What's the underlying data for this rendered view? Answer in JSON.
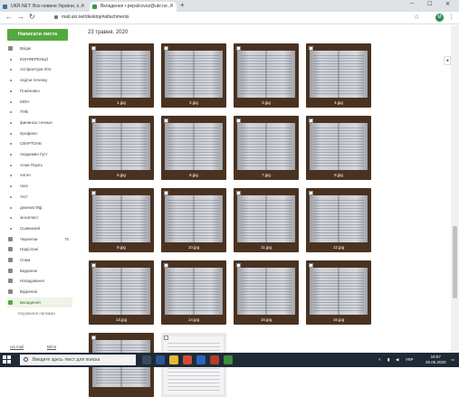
{
  "browser": {
    "tabs": [
      {
        "title": "UKR.NET: Все новини України, о..."
      },
      {
        "title": "Вкладення • pepalcovoz@ukr.ne..."
      }
    ],
    "url": "mail.ukr.net/desktop#attachments",
    "avatar_letter": "M"
  },
  "sidebar": {
    "compose_label": "Написати листа",
    "folders": [
      {
        "label": "Вхідні",
        "icon": "inbox-icon"
      },
      {
        "label": "КОНФЕРЕНЦІЇ",
        "icon": "folder-dot"
      },
      {
        "label": "Аспірантура 204",
        "icon": "folder-dot"
      },
      {
        "label": "свідчи теченку",
        "icon": "folder-dot"
      },
      {
        "label": "Помічнико",
        "icon": "folder-dot"
      },
      {
        "label": "МОН",
        "icon": "folder-dot"
      },
      {
        "label": "ТНВ",
        "icon": "folder-dot"
      },
      {
        "label": "финансы сочные",
        "icon": "folder-dot"
      },
      {
        "label": "профили",
        "icon": "folder-dot"
      },
      {
        "label": "СВАРТОАБ",
        "icon": "folder-dot"
      },
      {
        "label": "Академия Густ",
        "icon": "folder-dot"
      },
      {
        "label": "Алиа Паупъ",
        "icon": "folder-dot"
      },
      {
        "label": "чатон",
        "icon": "folder-dot"
      },
      {
        "label": "гаха",
        "icon": "folder-dot"
      },
      {
        "label": "тест",
        "icon": "folder-dot"
      },
      {
        "label": "декенат.Фф",
        "icon": "folder-dot"
      },
      {
        "label": "экзопласт",
        "icon": "folder-dot"
      },
      {
        "label": "Сшмнизей",
        "icon": "folder-dot"
      },
      {
        "label": "Чернетки",
        "icon": "drafts-icon",
        "count": "76"
      },
      {
        "label": "Надіслані",
        "icon": "sent-icon"
      },
      {
        "label": "Спам",
        "icon": "spam-icon"
      },
      {
        "label": "Видалені",
        "icon": "trash-icon"
      },
      {
        "label": "Нагадування",
        "icon": "reminder-icon"
      },
      {
        "label": "Відмічені",
        "icon": "star-icon"
      },
      {
        "label": "Вкладення",
        "icon": "attachment-icon",
        "active": true
      }
    ],
    "manage_label": "Керування папками",
    "footer": [
      "Ua mail",
      "Вйти"
    ]
  },
  "main": {
    "date_heading": "23 травня, 2020",
    "attachments": [
      "1.jpg",
      "2.jpg",
      "3.jpg",
      "4.jpg",
      "5.jpg",
      "6.jpg",
      "7.jpg",
      "8.jpg",
      "9.jpg",
      "10.jpg",
      "11.jpg",
      "12.jpg",
      "13.jpg",
      "14.jpg",
      "15.jpg",
      "16.jpg",
      "",
      ""
    ]
  },
  "taskbar": {
    "search_placeholder": "Введите здесь текст для поиска",
    "lang": "УКР",
    "time": "18:57",
    "date": "26.05.2020"
  }
}
